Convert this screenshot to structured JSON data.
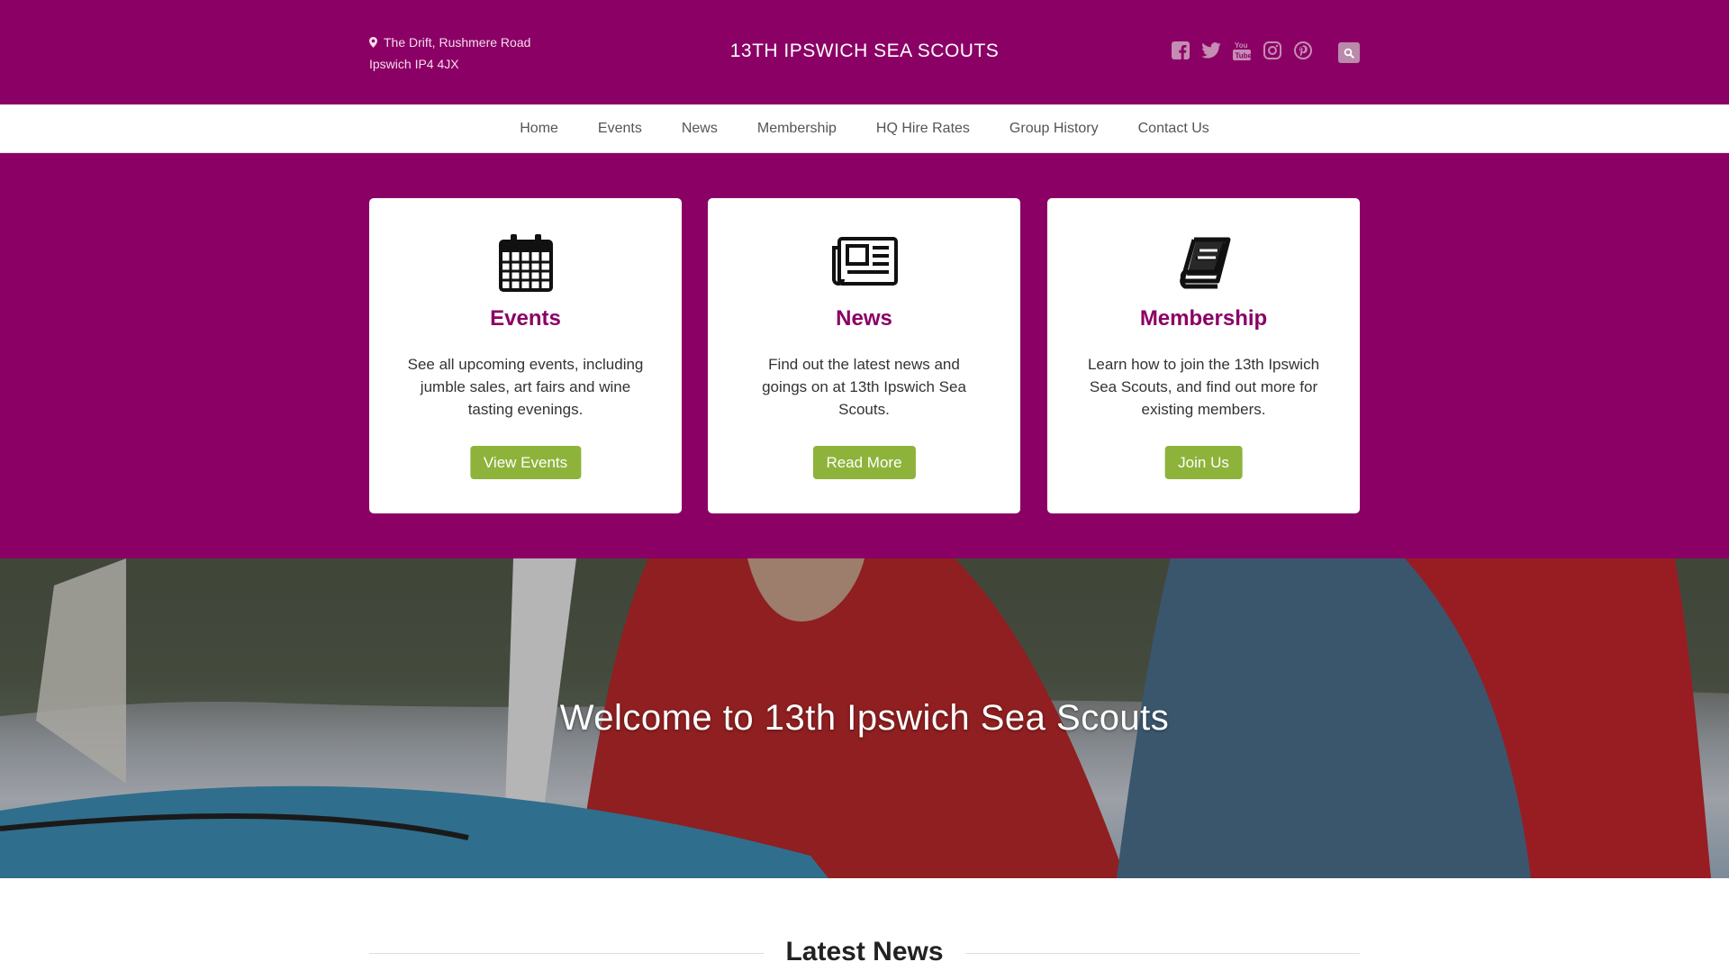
{
  "header": {
    "address_line1": "The Drift, Rushmere Road",
    "address_line2": "Ipswich IP4 4JX",
    "site_title": "13TH IPSWICH SEA SCOUTS",
    "social_icons": [
      "facebook-icon",
      "twitter-icon",
      "youtube-icon",
      "instagram-icon",
      "pinterest-icon"
    ],
    "search_icon": "search-icon"
  },
  "nav": {
    "items": [
      "Home",
      "Events",
      "News",
      "Membership",
      "HQ Hire Rates",
      "Group History",
      "Contact Us"
    ]
  },
  "cards": [
    {
      "icon": "calendar-icon",
      "title": "Events",
      "text": "See all upcoming events, including jumble sales, art fairs and wine tasting evenings.",
      "button": "View Events"
    },
    {
      "icon": "newspaper-icon",
      "title": "News",
      "text": "Find out the latest news and goings on at 13th Ipswich Sea Scouts.",
      "button": "Read More"
    },
    {
      "icon": "book-icon",
      "title": "Membership",
      "text": "Learn how to join the 13th Ipswich Sea Scouts, and find out more for existing members.",
      "button": "Join Us"
    }
  ],
  "hero": {
    "heading": "Welcome to 13th Ipswich Sea Scouts"
  },
  "latest": {
    "heading": "Latest News"
  },
  "colors": {
    "brand": "#8b0065",
    "button": "#8db33a",
    "nav_text": "#555555"
  }
}
